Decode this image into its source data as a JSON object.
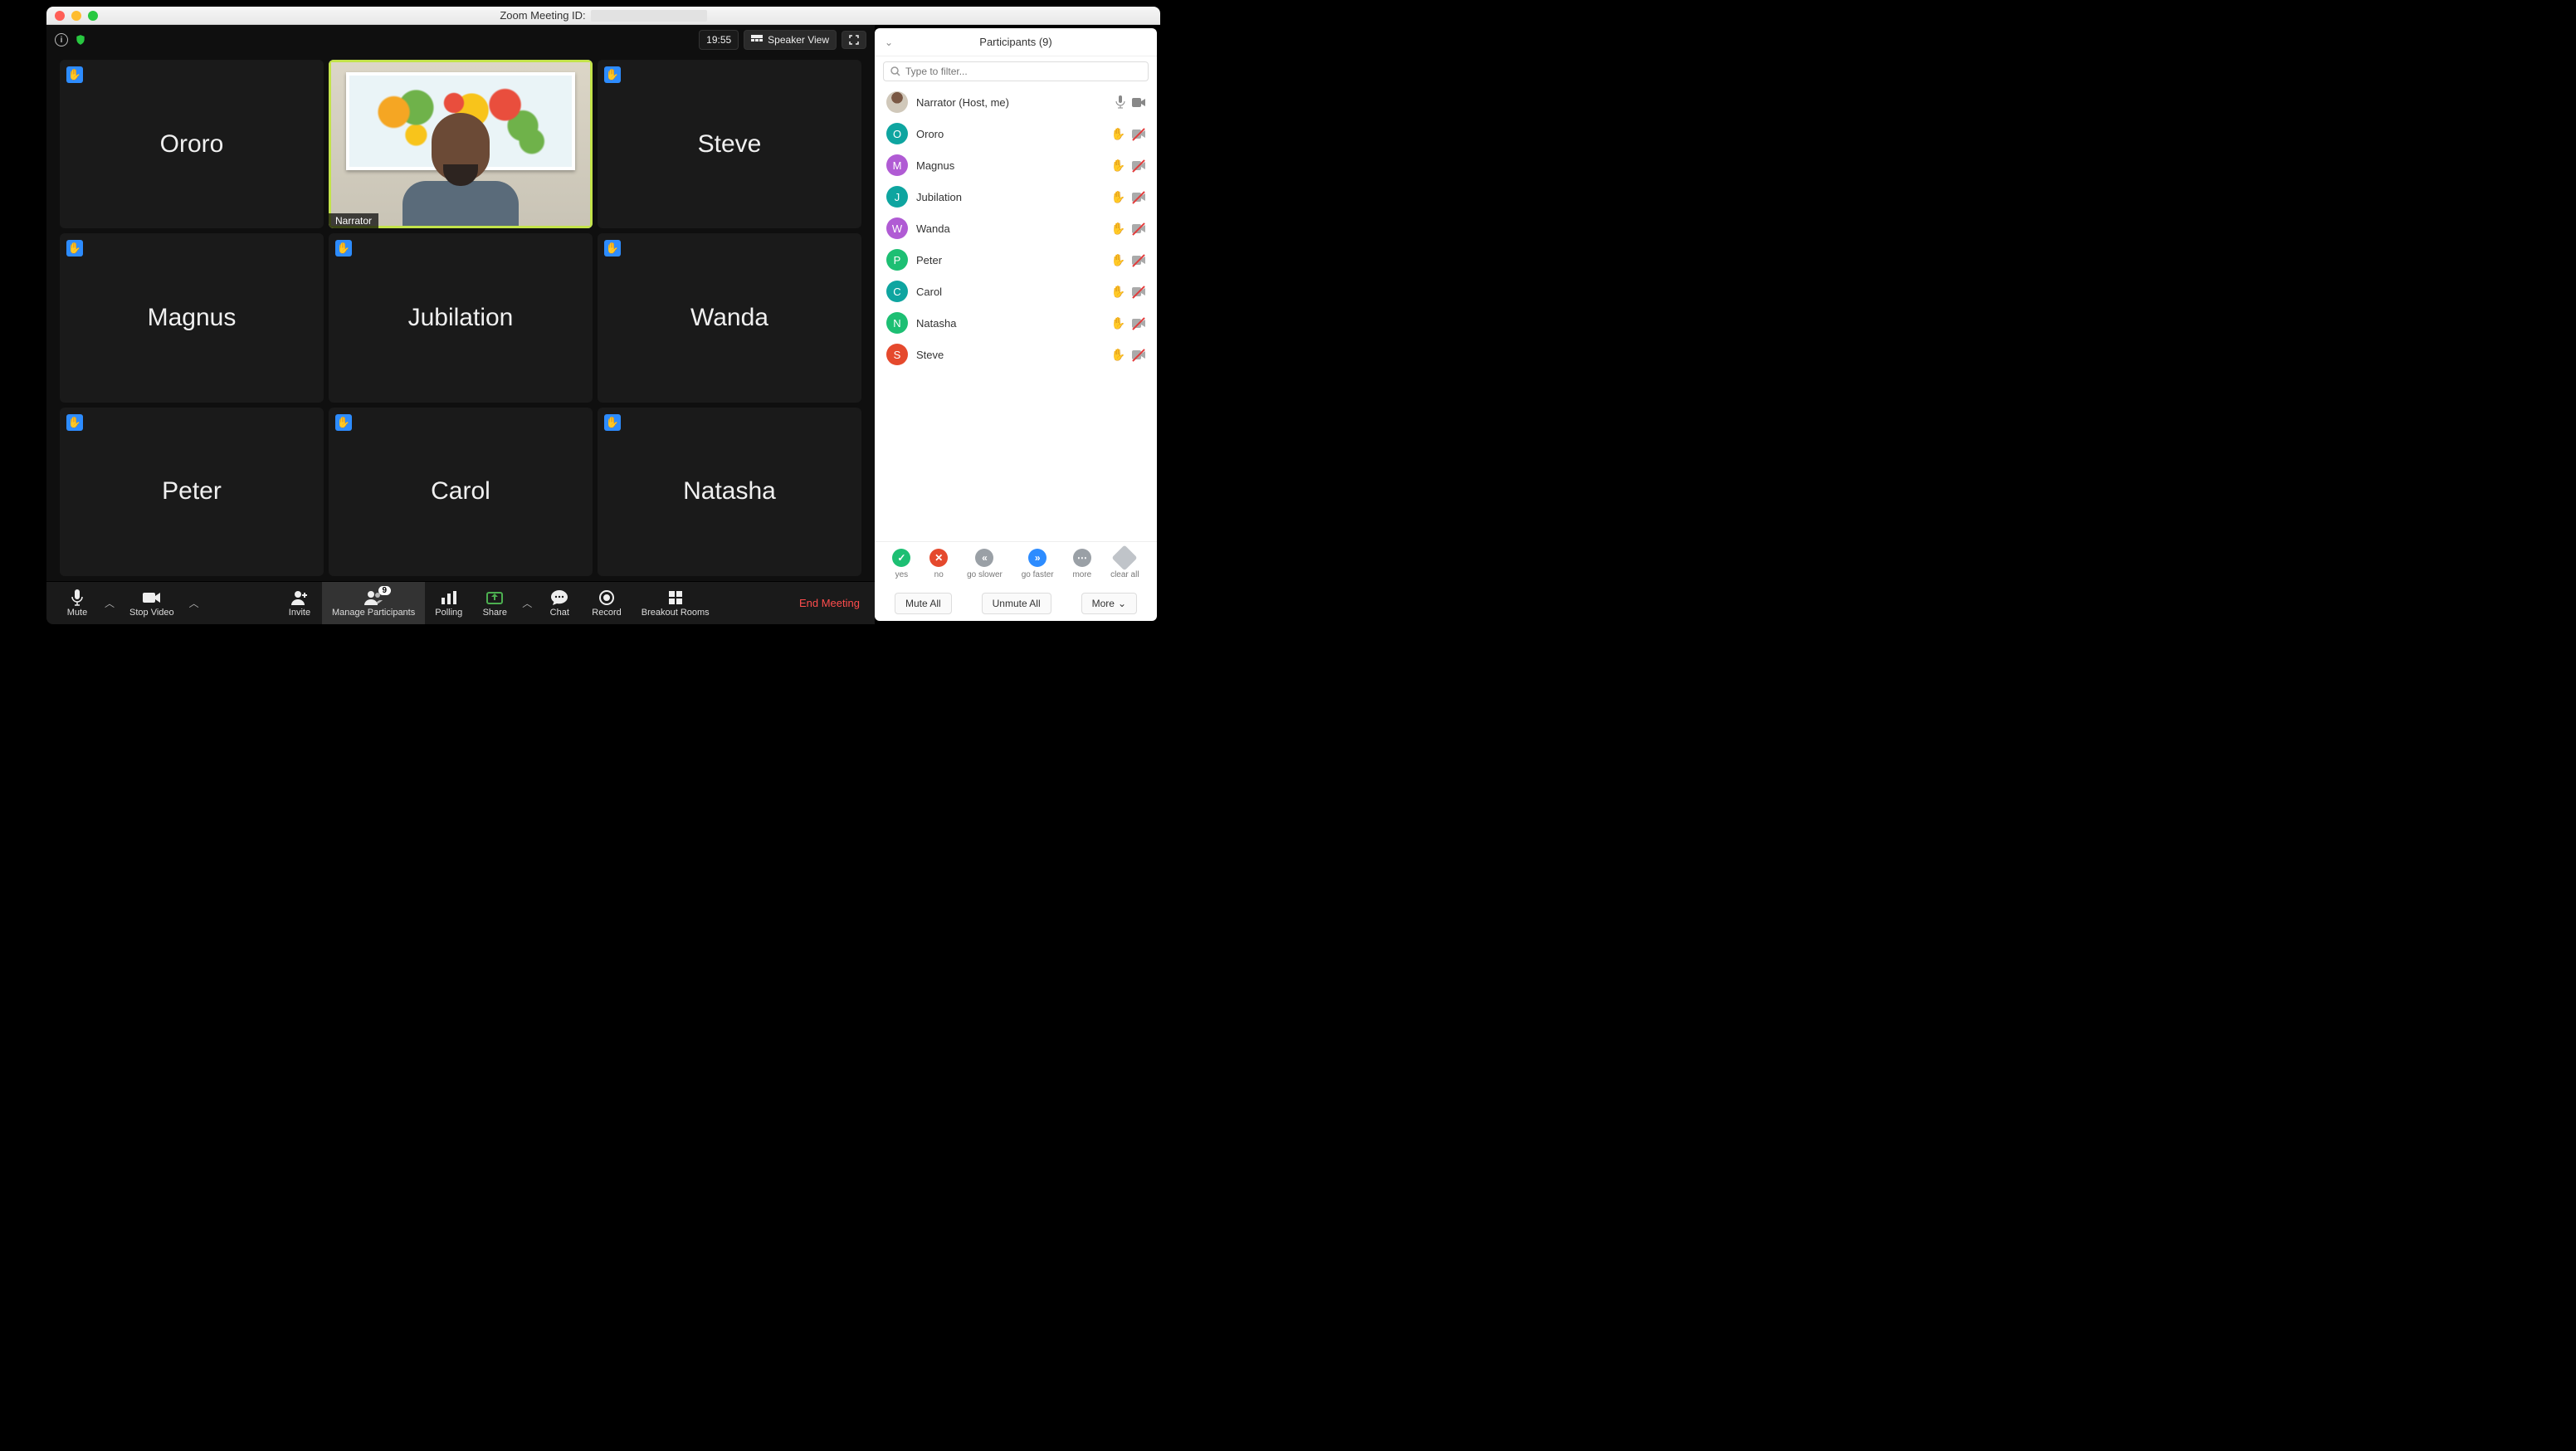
{
  "window": {
    "title_prefix": "Zoom Meeting ID:"
  },
  "topbar": {
    "time": "19:55",
    "speaker_view": "Speaker View"
  },
  "toolbar": {
    "mute": "Mute",
    "stop_video": "Stop Video",
    "invite": "Invite",
    "manage_participants": "Manage Participants",
    "participant_badge": "9",
    "polling": "Polling",
    "share": "Share",
    "chat": "Chat",
    "record": "Record",
    "breakout": "Breakout Rooms",
    "end": "End Meeting"
  },
  "grid": {
    "narrator_label": "Narrator",
    "tiles": [
      "Ororo",
      "Narrator",
      "Steve",
      "Magnus",
      "Jubilation",
      "Wanda",
      "Peter",
      "Carol",
      "Natasha"
    ]
  },
  "panel": {
    "heading": "Participants (9)",
    "filter_placeholder": "Type to filter...",
    "host_row": {
      "name": "Narrator (Host, me)"
    },
    "rows": [
      {
        "name": "Ororo",
        "initial": "O",
        "color": "#0ea5a0"
      },
      {
        "name": "Magnus",
        "initial": "M",
        "color": "#b05bd4"
      },
      {
        "name": "Jubilation",
        "initial": "J",
        "color": "#0ea5a0"
      },
      {
        "name": "Wanda",
        "initial": "W",
        "color": "#b05bd4"
      },
      {
        "name": "Peter",
        "initial": "P",
        "color": "#1dbf73"
      },
      {
        "name": "Carol",
        "initial": "C",
        "color": "#0ea5a0"
      },
      {
        "name": "Natasha",
        "initial": "N",
        "color": "#1dbf73"
      },
      {
        "name": "Steve",
        "initial": "S",
        "color": "#e5492d"
      }
    ],
    "reactions": {
      "yes": "yes",
      "no": "no",
      "slower": "go slower",
      "faster": "go faster",
      "more": "more",
      "clear": "clear all"
    },
    "footer": {
      "mute_all": "Mute All",
      "unmute_all": "Unmute All",
      "more": "More"
    }
  }
}
